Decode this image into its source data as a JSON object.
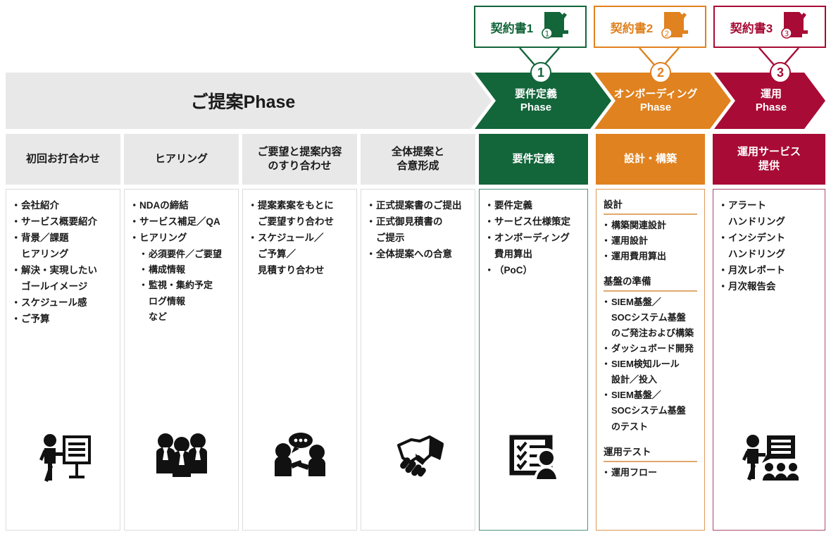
{
  "colors": {
    "green": "#13653a",
    "orange": "#e0821f",
    "red": "#a80b35",
    "grey": "#e8e8e8",
    "green_border": "#4e947a",
    "orange_border": "#dd9a55",
    "red_border": "#ab4a6d",
    "text": "#1a1a1a",
    "white": "#ffffff"
  },
  "contracts": [
    {
      "label": "契約書1",
      "number": "①",
      "color": "#13653a",
      "icon": "contract-scroll-icon"
    },
    {
      "label": "契約書2",
      "number": "②",
      "color": "#e0821f",
      "icon": "contract-scroll-icon"
    },
    {
      "label": "契約書3",
      "number": "③",
      "color": "#a80b35",
      "icon": "contract-scroll-icon"
    }
  ],
  "phases": [
    {
      "id": "proposal",
      "title": "ご提案Phase",
      "subtitle": "",
      "badge": "",
      "color": "#e8e8e8",
      "text_color": "#1a1a1a"
    },
    {
      "id": "requirements",
      "title": "要件定義",
      "subtitle": "Phase",
      "badge": "1",
      "color": "#13653a",
      "text_color": "#ffffff"
    },
    {
      "id": "onboarding",
      "title": "オンボーディング",
      "subtitle": "Phase",
      "badge": "2",
      "color": "#e0821f",
      "text_color": "#ffffff"
    },
    {
      "id": "operation",
      "title": "運用",
      "subtitle": "Phase",
      "badge": "3",
      "color": "#a80b35",
      "text_color": "#ffffff"
    }
  ],
  "columns": [
    {
      "id": "first-meeting",
      "header": "初回お打合わせ",
      "header_style": "grey",
      "accent": "default",
      "icon": "presenter-board-icon",
      "items": [
        {
          "type": "bullet",
          "text": "会社紹介"
        },
        {
          "type": "bullet",
          "text": "サービス概要紹介"
        },
        {
          "type": "bullet",
          "text": "背景／課題"
        },
        {
          "type": "plain",
          "text": "ヒアリング"
        },
        {
          "type": "bullet",
          "text": "解決・実現したい"
        },
        {
          "type": "plain",
          "text": "ゴールイメージ"
        },
        {
          "type": "bullet",
          "text": "スケジュール感"
        },
        {
          "type": "bullet",
          "text": "ご予算"
        }
      ]
    },
    {
      "id": "hearing",
      "header": "ヒアリング",
      "header_style": "grey",
      "accent": "default",
      "icon": "three-people-icon",
      "items": [
        {
          "type": "bullet",
          "text": "NDAの締結"
        },
        {
          "type": "bullet",
          "text": "サービス補足／QA"
        },
        {
          "type": "bullet",
          "text": "ヒアリング"
        },
        {
          "type": "sub",
          "text": "必須要件／ご要望"
        },
        {
          "type": "sub",
          "text": "構成情報"
        },
        {
          "type": "sub",
          "text": "監視・集約予定"
        },
        {
          "type": "subplain",
          "text": "ログ情報"
        },
        {
          "type": "subplain",
          "text": "など"
        }
      ]
    },
    {
      "id": "requirement-alignment",
      "header": "ご要望と提案内容\nのすり合わせ",
      "header_style": "grey",
      "accent": "default",
      "icon": "conversation-icon",
      "items": [
        {
          "type": "bullet",
          "text": "提案素案をもとに"
        },
        {
          "type": "plain",
          "text": "ご要望すり合わせ"
        },
        {
          "type": "bullet",
          "text": "スケジュール／"
        },
        {
          "type": "plain",
          "text": "ご予算／"
        },
        {
          "type": "plain",
          "text": "見積すり合わせ"
        }
      ]
    },
    {
      "id": "overall-proposal-agreement",
      "header": "全体提案と\n合意形成",
      "header_style": "grey",
      "accent": "default",
      "icon": "handshake-icon",
      "items": [
        {
          "type": "bullet",
          "text": "正式提案書のご提出"
        },
        {
          "type": "bullet",
          "text": "正式御見積書の"
        },
        {
          "type": "plain",
          "text": "ご提示"
        },
        {
          "type": "bullet",
          "text": "全体提案への合意"
        }
      ]
    },
    {
      "id": "requirement-definition",
      "header": "要件定義",
      "header_style": "green",
      "accent": "green",
      "icon": "checklist-person-icon",
      "items": [
        {
          "type": "bullet",
          "text": "要件定義"
        },
        {
          "type": "bullet",
          "text": "サービス仕様策定"
        },
        {
          "type": "bullet",
          "text": "オンボーディング"
        },
        {
          "type": "plain",
          "text": "費用算出"
        },
        {
          "type": "bullet",
          "text": "（PoC）"
        }
      ]
    },
    {
      "id": "design-build",
      "header": "設計・構築",
      "header_style": "orange",
      "accent": "orange",
      "icon": "",
      "groups": [
        {
          "title": "設計",
          "items": [
            {
              "type": "bullet",
              "text": "構築関連設計"
            },
            {
              "type": "bullet",
              "text": "運用設計"
            },
            {
              "type": "bullet",
              "text": "運用費用算出"
            }
          ]
        },
        {
          "title": "基盤の準備",
          "items": [
            {
              "type": "bullet",
              "text": "SIEM基盤／"
            },
            {
              "type": "plain",
              "text": "SOCシステム基盤"
            },
            {
              "type": "plain",
              "text": "のご発注および構築"
            },
            {
              "type": "bullet",
              "text": "ダッシュボード開発"
            },
            {
              "type": "bullet",
              "text": "SIEM検知ルール"
            },
            {
              "type": "plain",
              "text": "設計／投入"
            },
            {
              "type": "bullet",
              "text": "SIEM基盤／"
            },
            {
              "type": "plain",
              "text": "SOCシステム基盤"
            },
            {
              "type": "plain",
              "text": "のテスト"
            }
          ]
        },
        {
          "title": "運用テスト",
          "items": [
            {
              "type": "bullet",
              "text": "運用フロー"
            }
          ]
        }
      ]
    },
    {
      "id": "operation-service",
      "header": "運用サービス\n提供",
      "header_style": "red",
      "accent": "red",
      "icon": "presenter-audience-icon",
      "items": [
        {
          "type": "bullet",
          "text": "アラート"
        },
        {
          "type": "plain",
          "text": "ハンドリング"
        },
        {
          "type": "bullet",
          "text": "インシデント"
        },
        {
          "type": "plain",
          "text": "ハンドリング"
        },
        {
          "type": "bullet",
          "text": "月次レポート"
        },
        {
          "type": "bullet",
          "text": "月次報告会"
        }
      ]
    }
  ]
}
